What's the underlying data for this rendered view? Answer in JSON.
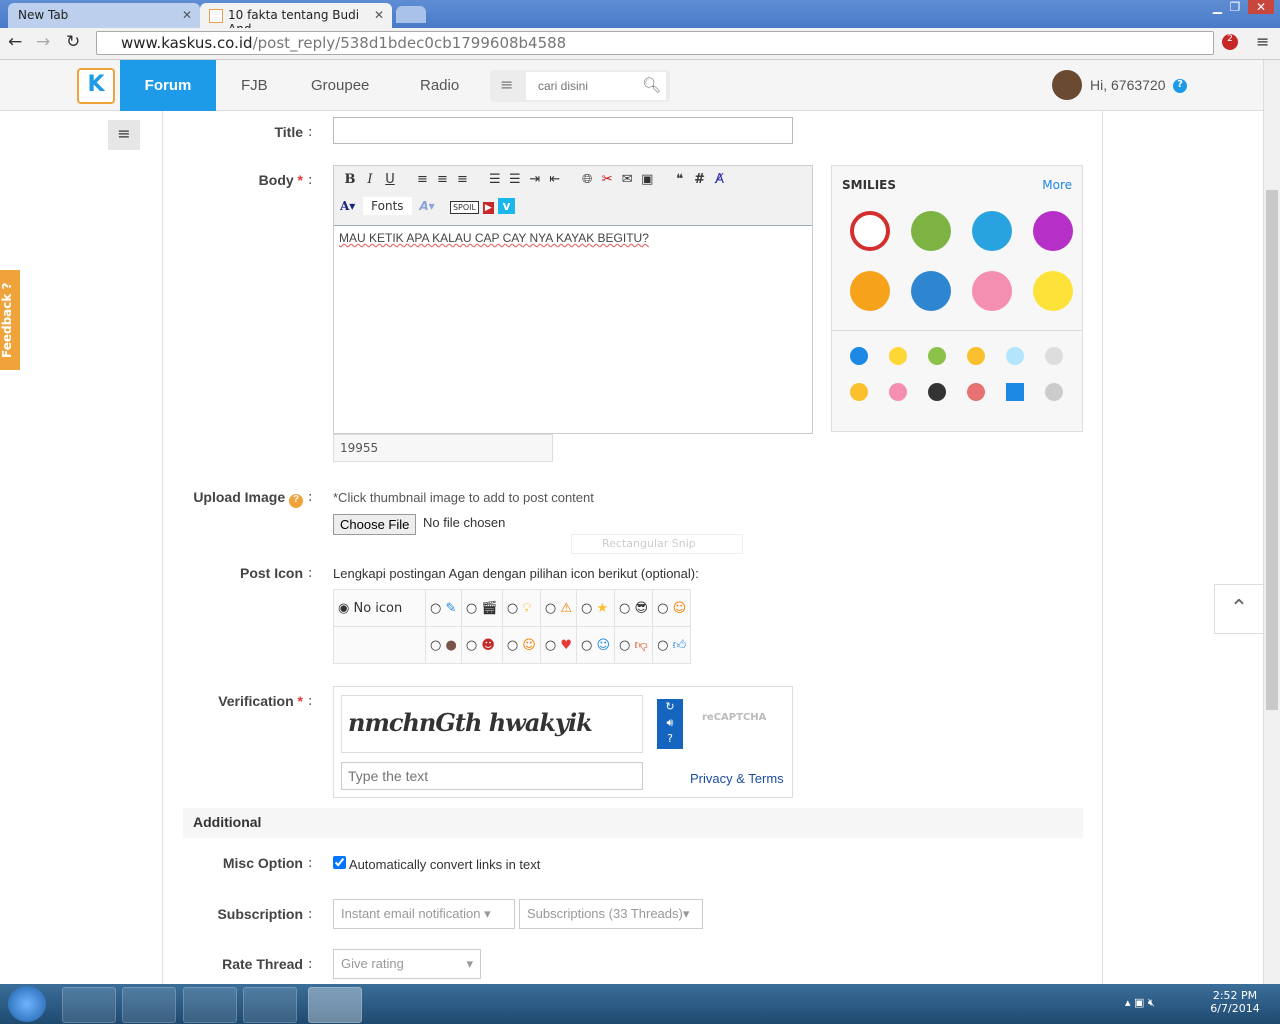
{
  "browser": {
    "tabs": [
      {
        "label": "New Tab"
      },
      {
        "label": "10 fakta tentang Budi And"
      }
    ],
    "url_host": "www.kaskus.co.id",
    "url_path": "/post_reply/538d1bdec0cb1799608b4588",
    "ext_badge": "2"
  },
  "nav": {
    "items": [
      "Forum",
      "FJB",
      "Groupee",
      "Radio"
    ],
    "search_placeholder": "cari disini",
    "greeting": "Hi, 6763720",
    "accent": "#1e9be8"
  },
  "form": {
    "title_label": "Title",
    "body_label": "Body",
    "required": "*",
    "colon": ":",
    "toolbar": {
      "fonts": "Fonts",
      "spoil": "SPOIL"
    },
    "body_text": "MAU KETIK APA KALAU CAP CAY NYA KAYAK BEGITU?",
    "char_count": "19955",
    "smilies": {
      "title": "SMILIES",
      "more": "More"
    },
    "upload_label": "Upload Image",
    "upload_hint": "*Click thumbnail image to add to post content",
    "choose_file": "Choose File",
    "no_file": "No file chosen",
    "snip_overlay": "Rectangular Snip",
    "post_icon_label": "Post Icon",
    "post_icon_hint": "Lengkapi postingan Agan dengan pilihan icon berikut (optional):",
    "no_icon": "No icon",
    "verification_label": "Verification",
    "captcha_placeholder": "Type the text",
    "privacy": "Privacy & Terms",
    "captcha_text": "nmchnGth hwakyik",
    "recaptcha": "reCAPTCHA",
    "additional": "Additional",
    "misc_label": "Misc Option",
    "misc_check": "Automatically convert links in text",
    "misc_checked": true,
    "subscription_label": "Subscription",
    "subscription_value": "Instant email notification",
    "subscriptions_value": "Subscriptions (33 Threads)",
    "rate_label": "Rate Thread",
    "rate_value": "Give rating"
  },
  "feedback": "Feedback ?",
  "clock": {
    "time": "2:52 PM",
    "date": "6/7/2014"
  }
}
